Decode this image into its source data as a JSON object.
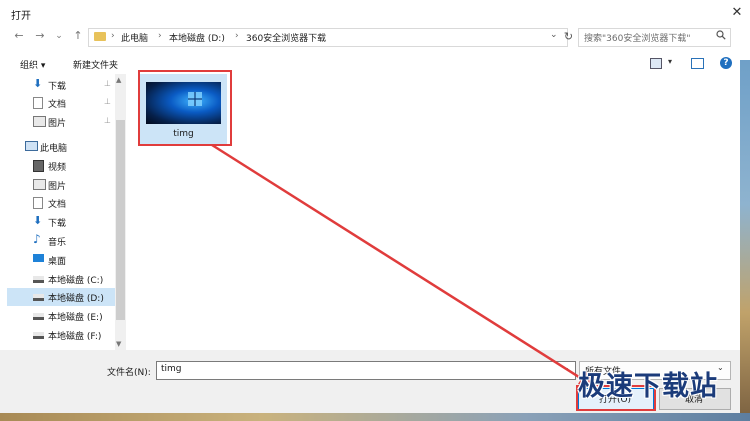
{
  "window": {
    "title": "打开",
    "close_label": "✕"
  },
  "nav": {
    "back": "←",
    "forward": "→",
    "dropdown": "⌄",
    "up": "↑",
    "refresh": "↻"
  },
  "address": {
    "crumb_sep": "›",
    "crumbs": [
      "此电脑",
      "本地磁盘 (D:)",
      "360安全浏览器下载"
    ],
    "dropdown": "⌄"
  },
  "search": {
    "placeholder": "搜索\"360安全浏览器下载\"",
    "icon": "search-icon"
  },
  "toolbar": {
    "organize": "组织 ▾",
    "new_folder": "新建文件夹",
    "view_dropdown": "▾",
    "help": "?"
  },
  "sidebar": {
    "items": [
      {
        "label": "下载",
        "icon": "download-icon",
        "pinned": true
      },
      {
        "label": "文档",
        "icon": "document-icon",
        "pinned": true
      },
      {
        "label": "图片",
        "icon": "picture-icon",
        "pinned": true
      },
      {
        "label": "此电脑",
        "icon": "computer-icon",
        "pinned": false
      },
      {
        "label": "视频",
        "icon": "video-icon",
        "pinned": false
      },
      {
        "label": "图片",
        "icon": "picture-icon",
        "pinned": false
      },
      {
        "label": "文档",
        "icon": "document-icon",
        "pinned": false
      },
      {
        "label": "下载",
        "icon": "download-icon",
        "pinned": false
      },
      {
        "label": "音乐",
        "icon": "music-icon",
        "pinned": false
      },
      {
        "label": "桌面",
        "icon": "desktop-icon",
        "pinned": false
      },
      {
        "label": "本地磁盘 (C:)",
        "icon": "drive-icon",
        "pinned": false
      },
      {
        "label": "本地磁盘 (D:)",
        "icon": "drive-icon",
        "pinned": false,
        "selected": true
      },
      {
        "label": "本地磁盘 (E:)",
        "icon": "drive-icon",
        "pinned": false
      },
      {
        "label": "本地磁盘 (F:)",
        "icon": "drive-icon",
        "pinned": false
      }
    ],
    "pin_glyph": "📌"
  },
  "files": [
    {
      "name": "timg",
      "type": "image",
      "selected": true
    }
  ],
  "bottom": {
    "filename_label": "文件名(N):",
    "filename_value": "timg",
    "filetype_value": "所有文件",
    "dropdown": "⌄",
    "open_label": "打开(O)",
    "cancel_label": "取消"
  },
  "watermark": "极速下载站",
  "colors": {
    "accent": "#0078d7",
    "highlight": "#e03c3c",
    "selection": "#cce4f7"
  }
}
